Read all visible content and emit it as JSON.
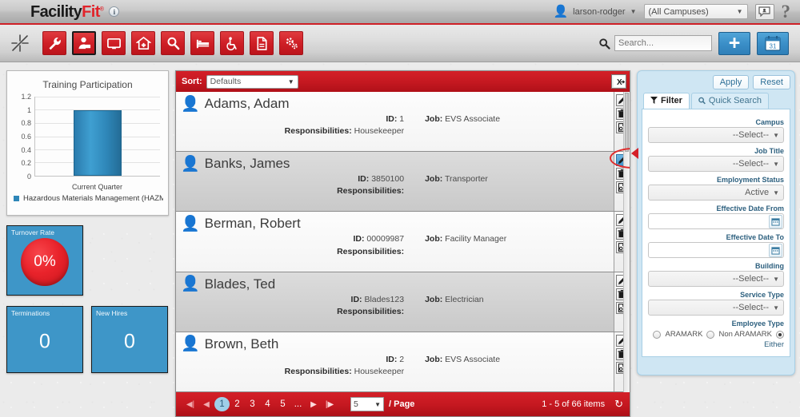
{
  "header": {
    "logo_primary": "Facility",
    "logo_accent": "Fit",
    "logo_tm": "®",
    "info_icon": "info-circle-icon",
    "user_name": "larson-rodger",
    "user_caret": "▼",
    "campus_value": "(All Campuses)",
    "campus_caret": "▼",
    "messages_icon": "contacts-icon",
    "help_label": "?"
  },
  "toolbar": {
    "sparkle_icon": "sparkle-icon",
    "nav_items": [
      {
        "icon": "wrench-icon",
        "active": false
      },
      {
        "icon": "person-user-icon",
        "active": true
      },
      {
        "icon": "monitor-icon",
        "active": false
      },
      {
        "icon": "hospital-home-icon",
        "active": false
      },
      {
        "icon": "magnifier-icon",
        "active": false
      },
      {
        "icon": "bed-icon",
        "active": false
      },
      {
        "icon": "wheelchair-icon",
        "active": false
      },
      {
        "icon": "document-icon",
        "active": false
      },
      {
        "icon": "gears-icon",
        "active": false
      }
    ],
    "search_icon": "search-icon",
    "search_value": "",
    "search_placeholder": "Search...",
    "add_label": "+",
    "calendar_icon": "calendar-icon",
    "calendar_day": "31"
  },
  "dashboard": {
    "turnover": {
      "label": "Turnover Rate",
      "value": "0%"
    },
    "terminations": {
      "label": "Terminations",
      "value": "0"
    },
    "new_hires": {
      "label": "New Hires",
      "value": "0"
    }
  },
  "chart_data": {
    "type": "bar",
    "title": "Training Participation",
    "categories": [
      "Current Quarter"
    ],
    "series": [
      {
        "name": "Hazardous Materials Management (HAZMAT)",
        "values": [
          1
        ],
        "color": "#2e86b8"
      }
    ],
    "values": [
      1
    ],
    "xlabel": "",
    "ylabel": "",
    "ylim": [
      0,
      1.2
    ],
    "yticks": [
      0,
      0.2,
      0.4,
      0.6,
      0.8,
      1,
      1.2
    ],
    "ytick_labels": [
      "0",
      "0.2",
      "0.4",
      "0.6",
      "0.8",
      "1",
      "1.2"
    ],
    "grid": true,
    "legend_position": "bottom",
    "legend": [
      "Hazardous Materials Management (HAZMAT"
    ]
  },
  "list": {
    "sort_label": "Sort:",
    "sort_value": "Defaults",
    "sort_caret": "▼",
    "export_icon": "export-excel-icon",
    "field_labels": {
      "id": "ID:",
      "job": "Job:",
      "responsibilities": "Responsibilities:"
    },
    "row_actions": [
      {
        "name": "edit-button",
        "icon": "pencil-icon",
        "tooltip": "Edit"
      },
      {
        "name": "delete-button",
        "icon": "trash-icon",
        "tooltip": "Delete"
      },
      {
        "name": "report-button",
        "icon": "report-icon",
        "tooltip": "Report"
      }
    ],
    "employees": [
      {
        "name": "Adams, Adam",
        "id": "1",
        "job": "EVS Associate",
        "responsibilities": "Housekeeper",
        "shade": "plain"
      },
      {
        "name": "Banks, James",
        "id": "3850100",
        "job": "Transporter",
        "responsibilities": "",
        "shade": "alt"
      },
      {
        "name": "Berman, Robert",
        "id": "00009987",
        "job": "Facility Manager",
        "responsibilities": "",
        "shade": "plain"
      },
      {
        "name": "Blades, Ted",
        "id": "Blades123",
        "job": "Electrician",
        "responsibilities": "",
        "shade": "alt"
      },
      {
        "name": "Brown, Beth",
        "id": "2",
        "job": "EVS Associate",
        "responsibilities": "Housekeeper",
        "shade": "plain"
      }
    ],
    "highlight": {
      "row_index": 1,
      "action": "edit-button",
      "tooltip": "Edit",
      "ring_color": "#e02b2b"
    }
  },
  "pager": {
    "first_icon": "◀|",
    "prev_icon": "◀",
    "pages": [
      "1",
      "2",
      "3",
      "4",
      "5",
      "..."
    ],
    "current_page": "1",
    "next_icon": "▶",
    "last_icon": "|▶",
    "per_page_value": "5",
    "per_page_caret": "▼",
    "per_page_label": "/ Page",
    "items_text": "1 - 5 of 66 items",
    "refresh_icon": "refresh-icon"
  },
  "filter": {
    "apply_label": "Apply",
    "reset_label": "Reset",
    "tabs": [
      {
        "label": "Filter",
        "icon": "funnel-icon",
        "active": true
      },
      {
        "label": "Quick Search",
        "icon": "magnifier-icon",
        "active": false
      }
    ],
    "fields": [
      {
        "label": "Campus",
        "type": "select",
        "value": "--Select--"
      },
      {
        "label": "Job Title",
        "type": "select",
        "value": "--Select--"
      },
      {
        "label": "Employment Status",
        "type": "select",
        "value": "Active"
      },
      {
        "label": "Effective Date From",
        "type": "date",
        "value": ""
      },
      {
        "label": "Effective Date To",
        "type": "date",
        "value": ""
      },
      {
        "label": "Building",
        "type": "select",
        "value": "--Select--"
      },
      {
        "label": "Service Type",
        "type": "select",
        "value": "--Select--"
      }
    ],
    "employee_type": {
      "label": "Employee Type",
      "options": [
        {
          "label": "ARAMARK",
          "selected": false
        },
        {
          "label": "Non ARAMARK",
          "selected": false
        },
        {
          "label": "Either",
          "selected": true
        }
      ],
      "either_label": "Either"
    },
    "caret": "▼",
    "calendar_icon": "calendar-icon"
  },
  "colors": {
    "brand_red": "#cf2027",
    "accent_blue": "#3e96c8",
    "panel_blue": "#cfe6f3",
    "annotation_red": "#e02b2b"
  }
}
